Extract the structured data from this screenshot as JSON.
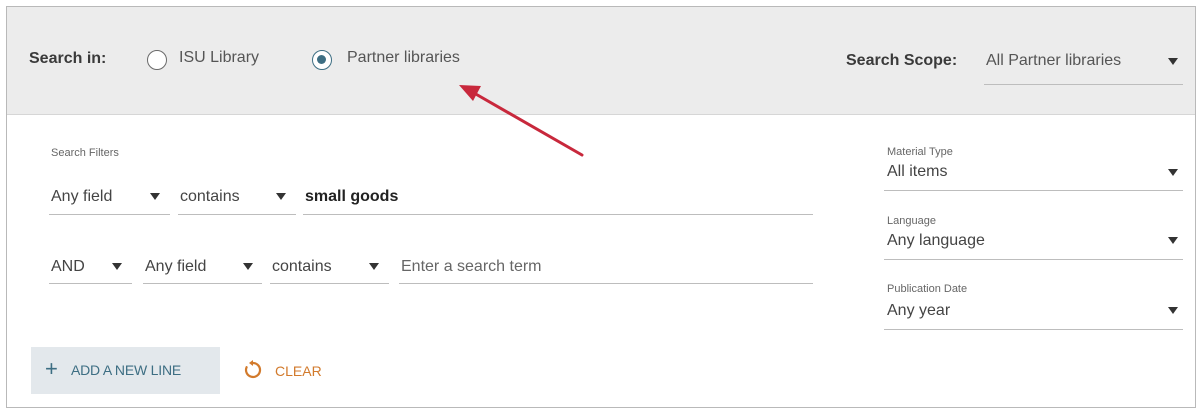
{
  "search_in": {
    "label": "Search in:",
    "options": [
      {
        "label": "ISU Library",
        "selected": false
      },
      {
        "label": "Partner libraries",
        "selected": true
      }
    ]
  },
  "search_scope": {
    "label": "Search Scope:",
    "value": "All Partner libraries"
  },
  "filters": {
    "title": "Search Filters",
    "line1": {
      "field": "Any field",
      "operator": "contains",
      "value": "small goods"
    },
    "line2": {
      "boolean": "AND",
      "field": "Any field",
      "operator": "contains",
      "placeholder": "Enter a search term"
    }
  },
  "facets": [
    {
      "label": "Material Type",
      "value": "All items"
    },
    {
      "label": "Language",
      "value": "Any language"
    },
    {
      "label": "Publication Date",
      "value": "Any year"
    }
  ],
  "actions": {
    "add_line": "ADD A NEW LINE",
    "clear": "CLEAR"
  },
  "colors": {
    "accent": "#3d6e83",
    "clear": "#d27a2c",
    "annotation_arrow": "#c8283c",
    "topbar_bg": "#ececec"
  }
}
